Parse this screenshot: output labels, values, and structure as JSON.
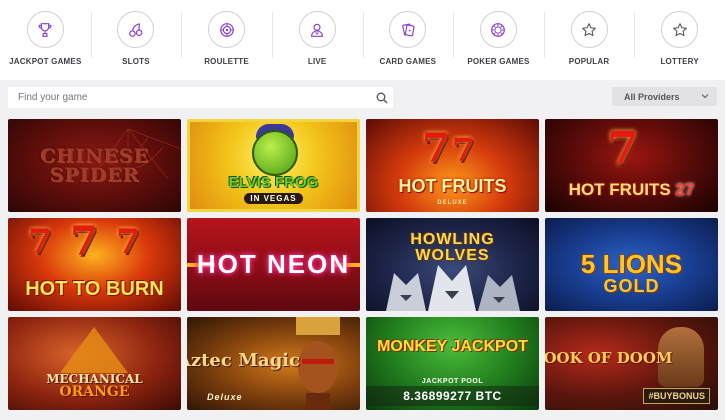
{
  "categories": [
    {
      "label": "JACKPOT GAMES",
      "icon": "trophy-icon"
    },
    {
      "label": "SLOTS",
      "icon": "cherries-icon"
    },
    {
      "label": "ROULETTE",
      "icon": "roulette-icon"
    },
    {
      "label": "LIVE",
      "icon": "dealer-icon"
    },
    {
      "label": "CARD GAMES",
      "icon": "cards-icon"
    },
    {
      "label": "POKER GAMES",
      "icon": "poker-chip-icon"
    },
    {
      "label": "POPULAR",
      "icon": "star-icon"
    },
    {
      "label": "LOTTERY",
      "icon": "star-icon"
    }
  ],
  "search": {
    "placeholder": "Find your game",
    "value": ""
  },
  "provider_filter": {
    "selected": "All Providers"
  },
  "games": [
    {
      "title": "CHINESE SPIDER"
    },
    {
      "title": "ELVIS FROG",
      "sub": "IN VEGAS"
    },
    {
      "title": "HOT FRUITS",
      "sub": "DELUXE"
    },
    {
      "title": "HOT FRUITS",
      "num": "27"
    },
    {
      "title": "HOT TO BURN"
    },
    {
      "title": "HOT NEON"
    },
    {
      "title": "HOWLING WOLVES"
    },
    {
      "title": "5 LIONS",
      "sub": "GOLD"
    },
    {
      "title": "MECHANICAL",
      "sub": "ORANGE"
    },
    {
      "title": "Aztec Magic",
      "sub": "Deluxe"
    },
    {
      "title": "MONKEY JACKPOT",
      "jackpot_label": "JACKPOT POOL",
      "jackpot_value": "8.36899277 BTC"
    },
    {
      "title": "BOOK OF DOOM",
      "badge": "#BUYBONUS"
    }
  ],
  "colors": {
    "background": "#f1f1f3",
    "category_bar": "#ffffff",
    "accent_icon": "#8b3fd0"
  }
}
